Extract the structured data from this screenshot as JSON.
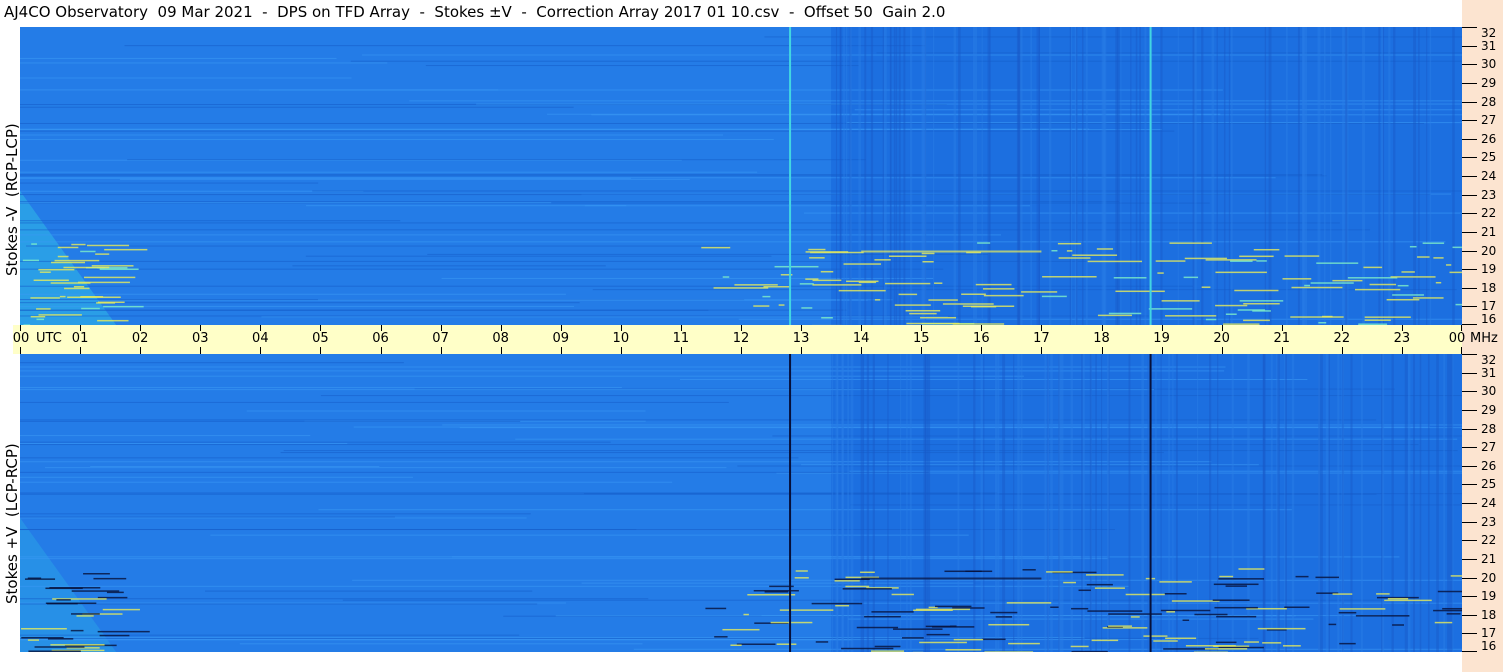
{
  "title": "AJ4CO Observatory  09 Mar 2021  -  DPS on TFD Array  -  Stokes ±V  -  Correction Array 2017 01 10.csv  -  Offset 50  Gain 2.0",
  "colors": {
    "background": "#1c6fe0",
    "background_light": "#2f8cf0",
    "band_light": "#2fb6e8",
    "burst_yellow": "#e8ec5a",
    "dark_line": "#06103a",
    "cyan_line": "#41d6e2",
    "time_strip": "#ffffc8",
    "freq_strip": "#fce4d0"
  },
  "chart_data": [
    {
      "type": "heatmap",
      "ylabel": "Stokes -V  (RCP-LCP)",
      "x_unit": "UTC",
      "y_unit": "MHz",
      "xlim": [
        0,
        24
      ],
      "ylim": [
        16,
        32
      ],
      "x_ticks": [
        "00",
        "01",
        "02",
        "03",
        "04",
        "05",
        "06",
        "07",
        "08",
        "09",
        "10",
        "11",
        "12",
        "13",
        "14",
        "15",
        "16",
        "17",
        "18",
        "19",
        "20",
        "21",
        "22",
        "23",
        "00"
      ],
      "y_ticks": [
        "16",
        "17",
        "18",
        "19",
        "20",
        "21",
        "22",
        "23",
        "24",
        "25",
        "26",
        "27",
        "28",
        "29",
        "30",
        "31",
        "32"
      ],
      "vertical_lines_utc": [
        12.8,
        18.8
      ],
      "vertical_line_style": "cyan"
    },
    {
      "type": "heatmap",
      "ylabel": "Stokes +V  (LCP-RCP)",
      "x_unit": "UTC",
      "y_unit": "MHz",
      "xlim": [
        0,
        24
      ],
      "ylim": [
        16,
        32
      ],
      "x_ticks": [
        "00",
        "01",
        "02",
        "03",
        "04",
        "05",
        "06",
        "07",
        "08",
        "09",
        "10",
        "11",
        "12",
        "13",
        "14",
        "15",
        "16",
        "17",
        "18",
        "19",
        "20",
        "21",
        "22",
        "23",
        "00"
      ],
      "y_ticks": [
        "16",
        "17",
        "18",
        "19",
        "20",
        "21",
        "22",
        "23",
        "24",
        "25",
        "26",
        "27",
        "28",
        "29",
        "30",
        "31",
        "32"
      ],
      "vertical_lines_utc": [
        12.8,
        18.8
      ],
      "vertical_line_style": "dark"
    }
  ]
}
